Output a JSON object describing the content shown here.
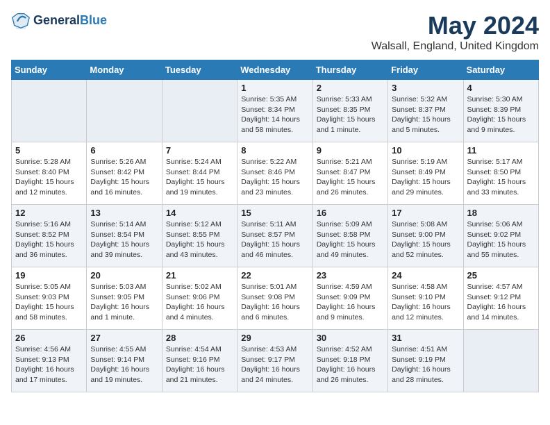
{
  "header": {
    "logo_line1": "General",
    "logo_line2": "Blue",
    "title": "May 2024",
    "subtitle": "Walsall, England, United Kingdom"
  },
  "days_of_week": [
    "Sunday",
    "Monday",
    "Tuesday",
    "Wednesday",
    "Thursday",
    "Friday",
    "Saturday"
  ],
  "weeks": [
    [
      {
        "day": "",
        "info": ""
      },
      {
        "day": "",
        "info": ""
      },
      {
        "day": "",
        "info": ""
      },
      {
        "day": "1",
        "info": "Sunrise: 5:35 AM\nSunset: 8:34 PM\nDaylight: 14 hours\nand 58 minutes."
      },
      {
        "day": "2",
        "info": "Sunrise: 5:33 AM\nSunset: 8:35 PM\nDaylight: 15 hours\nand 1 minute."
      },
      {
        "day": "3",
        "info": "Sunrise: 5:32 AM\nSunset: 8:37 PM\nDaylight: 15 hours\nand 5 minutes."
      },
      {
        "day": "4",
        "info": "Sunrise: 5:30 AM\nSunset: 8:39 PM\nDaylight: 15 hours\nand 9 minutes."
      }
    ],
    [
      {
        "day": "5",
        "info": "Sunrise: 5:28 AM\nSunset: 8:40 PM\nDaylight: 15 hours\nand 12 minutes."
      },
      {
        "day": "6",
        "info": "Sunrise: 5:26 AM\nSunset: 8:42 PM\nDaylight: 15 hours\nand 16 minutes."
      },
      {
        "day": "7",
        "info": "Sunrise: 5:24 AM\nSunset: 8:44 PM\nDaylight: 15 hours\nand 19 minutes."
      },
      {
        "day": "8",
        "info": "Sunrise: 5:22 AM\nSunset: 8:46 PM\nDaylight: 15 hours\nand 23 minutes."
      },
      {
        "day": "9",
        "info": "Sunrise: 5:21 AM\nSunset: 8:47 PM\nDaylight: 15 hours\nand 26 minutes."
      },
      {
        "day": "10",
        "info": "Sunrise: 5:19 AM\nSunset: 8:49 PM\nDaylight: 15 hours\nand 29 minutes."
      },
      {
        "day": "11",
        "info": "Sunrise: 5:17 AM\nSunset: 8:50 PM\nDaylight: 15 hours\nand 33 minutes."
      }
    ],
    [
      {
        "day": "12",
        "info": "Sunrise: 5:16 AM\nSunset: 8:52 PM\nDaylight: 15 hours\nand 36 minutes."
      },
      {
        "day": "13",
        "info": "Sunrise: 5:14 AM\nSunset: 8:54 PM\nDaylight: 15 hours\nand 39 minutes."
      },
      {
        "day": "14",
        "info": "Sunrise: 5:12 AM\nSunset: 8:55 PM\nDaylight: 15 hours\nand 43 minutes."
      },
      {
        "day": "15",
        "info": "Sunrise: 5:11 AM\nSunset: 8:57 PM\nDaylight: 15 hours\nand 46 minutes."
      },
      {
        "day": "16",
        "info": "Sunrise: 5:09 AM\nSunset: 8:58 PM\nDaylight: 15 hours\nand 49 minutes."
      },
      {
        "day": "17",
        "info": "Sunrise: 5:08 AM\nSunset: 9:00 PM\nDaylight: 15 hours\nand 52 minutes."
      },
      {
        "day": "18",
        "info": "Sunrise: 5:06 AM\nSunset: 9:02 PM\nDaylight: 15 hours\nand 55 minutes."
      }
    ],
    [
      {
        "day": "19",
        "info": "Sunrise: 5:05 AM\nSunset: 9:03 PM\nDaylight: 15 hours\nand 58 minutes."
      },
      {
        "day": "20",
        "info": "Sunrise: 5:03 AM\nSunset: 9:05 PM\nDaylight: 16 hours\nand 1 minute."
      },
      {
        "day": "21",
        "info": "Sunrise: 5:02 AM\nSunset: 9:06 PM\nDaylight: 16 hours\nand 4 minutes."
      },
      {
        "day": "22",
        "info": "Sunrise: 5:01 AM\nSunset: 9:08 PM\nDaylight: 16 hours\nand 6 minutes."
      },
      {
        "day": "23",
        "info": "Sunrise: 4:59 AM\nSunset: 9:09 PM\nDaylight: 16 hours\nand 9 minutes."
      },
      {
        "day": "24",
        "info": "Sunrise: 4:58 AM\nSunset: 9:10 PM\nDaylight: 16 hours\nand 12 minutes."
      },
      {
        "day": "25",
        "info": "Sunrise: 4:57 AM\nSunset: 9:12 PM\nDaylight: 16 hours\nand 14 minutes."
      }
    ],
    [
      {
        "day": "26",
        "info": "Sunrise: 4:56 AM\nSunset: 9:13 PM\nDaylight: 16 hours\nand 17 minutes."
      },
      {
        "day": "27",
        "info": "Sunrise: 4:55 AM\nSunset: 9:14 PM\nDaylight: 16 hours\nand 19 minutes."
      },
      {
        "day": "28",
        "info": "Sunrise: 4:54 AM\nSunset: 9:16 PM\nDaylight: 16 hours\nand 21 minutes."
      },
      {
        "day": "29",
        "info": "Sunrise: 4:53 AM\nSunset: 9:17 PM\nDaylight: 16 hours\nand 24 minutes."
      },
      {
        "day": "30",
        "info": "Sunrise: 4:52 AM\nSunset: 9:18 PM\nDaylight: 16 hours\nand 26 minutes."
      },
      {
        "day": "31",
        "info": "Sunrise: 4:51 AM\nSunset: 9:19 PM\nDaylight: 16 hours\nand 28 minutes."
      },
      {
        "day": "",
        "info": ""
      }
    ]
  ]
}
